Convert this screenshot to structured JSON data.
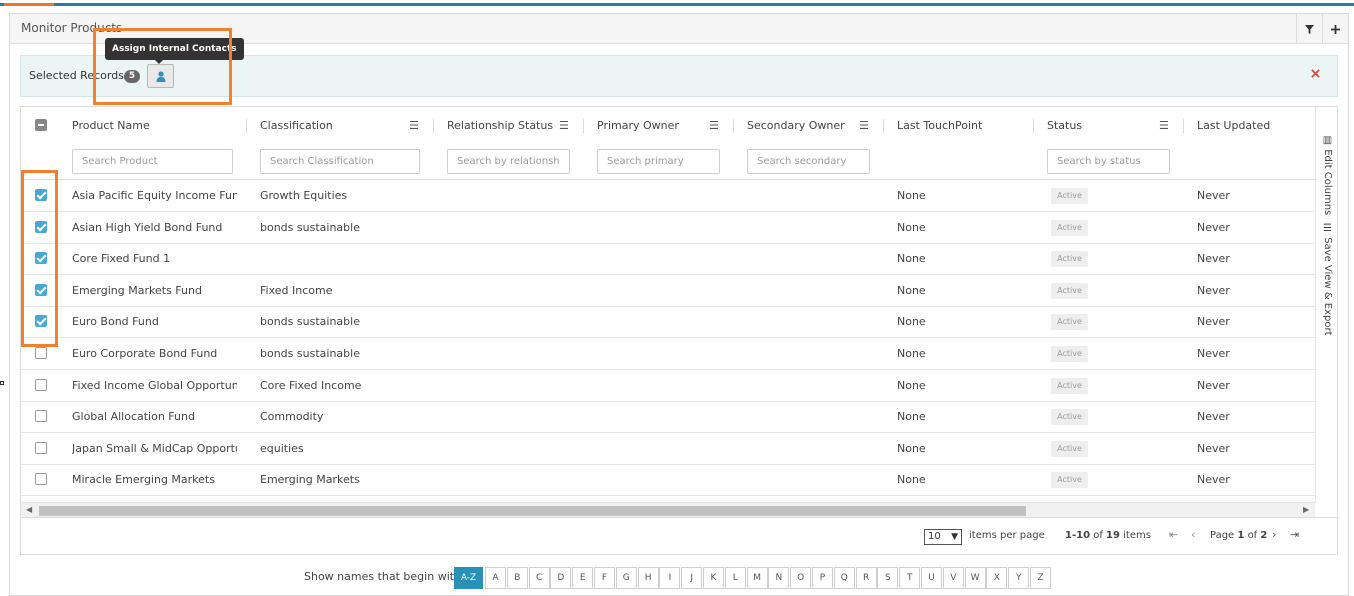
{
  "panel": {
    "title": "Monitor Products",
    "filter_icon": "filter-icon",
    "add_icon": "plus-icon"
  },
  "selection_bar": {
    "label": "Selected Records :",
    "count": "5",
    "assign_icon": "user-icon",
    "tooltip": "Assign Internal Contacts",
    "close_icon": "close-icon"
  },
  "columns": [
    {
      "title": "Product Name",
      "placeholder": "Search Product"
    },
    {
      "title": "Classification",
      "placeholder": "Search Classification"
    },
    {
      "title": "Relationship Status",
      "placeholder": "Search by relationship"
    },
    {
      "title": "Primary Owner",
      "placeholder": "Search primary"
    },
    {
      "title": "Secondary Owner",
      "placeholder": "Search secondary"
    },
    {
      "title": "Last TouchPoint",
      "placeholder": ""
    },
    {
      "title": "Status",
      "placeholder": "Search by status"
    },
    {
      "title": "Last Updated",
      "placeholder": ""
    }
  ],
  "rows": [
    {
      "checked": true,
      "name": "Asia Pacific Equity Income Fund",
      "classification": "Growth Equities",
      "touchpoint": "None",
      "status": "Active",
      "updated": "Never"
    },
    {
      "checked": true,
      "name": "Asian High Yield Bond Fund",
      "classification": "bonds sustainable",
      "touchpoint": "None",
      "status": "Active",
      "updated": "Never"
    },
    {
      "checked": true,
      "name": "Core Fixed Fund 1",
      "classification": "",
      "touchpoint": "None",
      "status": "Active",
      "updated": "Never"
    },
    {
      "checked": true,
      "name": "Emerging Markets Fund",
      "classification": "Fixed Income",
      "touchpoint": "None",
      "status": "Active",
      "updated": "Never"
    },
    {
      "checked": true,
      "name": "Euro Bond Fund",
      "classification": "bonds sustainable",
      "touchpoint": "None",
      "status": "Active",
      "updated": "Never"
    },
    {
      "checked": false,
      "name": "Euro Corporate Bond Fund",
      "classification": "bonds sustainable",
      "touchpoint": "None",
      "status": "Active",
      "updated": "Never"
    },
    {
      "checked": false,
      "name": "Fixed Income Global Opportuniti...",
      "classification": "Core Fixed Income",
      "touchpoint": "None",
      "status": "Active",
      "updated": "Never"
    },
    {
      "checked": false,
      "name": "Global Allocation Fund",
      "classification": "Commodity",
      "touchpoint": "None",
      "status": "Active",
      "updated": "Never"
    },
    {
      "checked": false,
      "name": "Japan Small & MidCap Opportu...",
      "classification": "equities",
      "touchpoint": "None",
      "status": "Active",
      "updated": "Never"
    },
    {
      "checked": false,
      "name": "Miracle Emerging Markets",
      "classification": "Emerging Markets",
      "touchpoint": "None",
      "status": "Active",
      "updated": "Never"
    }
  ],
  "side_tools": {
    "edit_columns": "Edit Columns",
    "save_view": "Save View & Export"
  },
  "pager": {
    "page_size": "10",
    "items_per_page": "items per page",
    "range": "1-10",
    "of_label": "of",
    "total": "19",
    "items_label": "items",
    "page_label": "Page",
    "current_page": "1",
    "page_of": "of",
    "total_pages": "2"
  },
  "alpha_filter": {
    "label": "Show names that begin with:",
    "active": "A-Z",
    "letters": [
      "A",
      "B",
      "C",
      "D",
      "E",
      "F",
      "G",
      "H",
      "I",
      "J",
      "K",
      "L",
      "M",
      "N",
      "O",
      "P",
      "Q",
      "R",
      "S",
      "T",
      "U",
      "V",
      "W",
      "X",
      "Y",
      "Z"
    ]
  },
  "colors": {
    "accent": "#2891b5",
    "highlight": "#f2812f",
    "checkbox": "#4aa9d4",
    "close": "#d9534f"
  }
}
